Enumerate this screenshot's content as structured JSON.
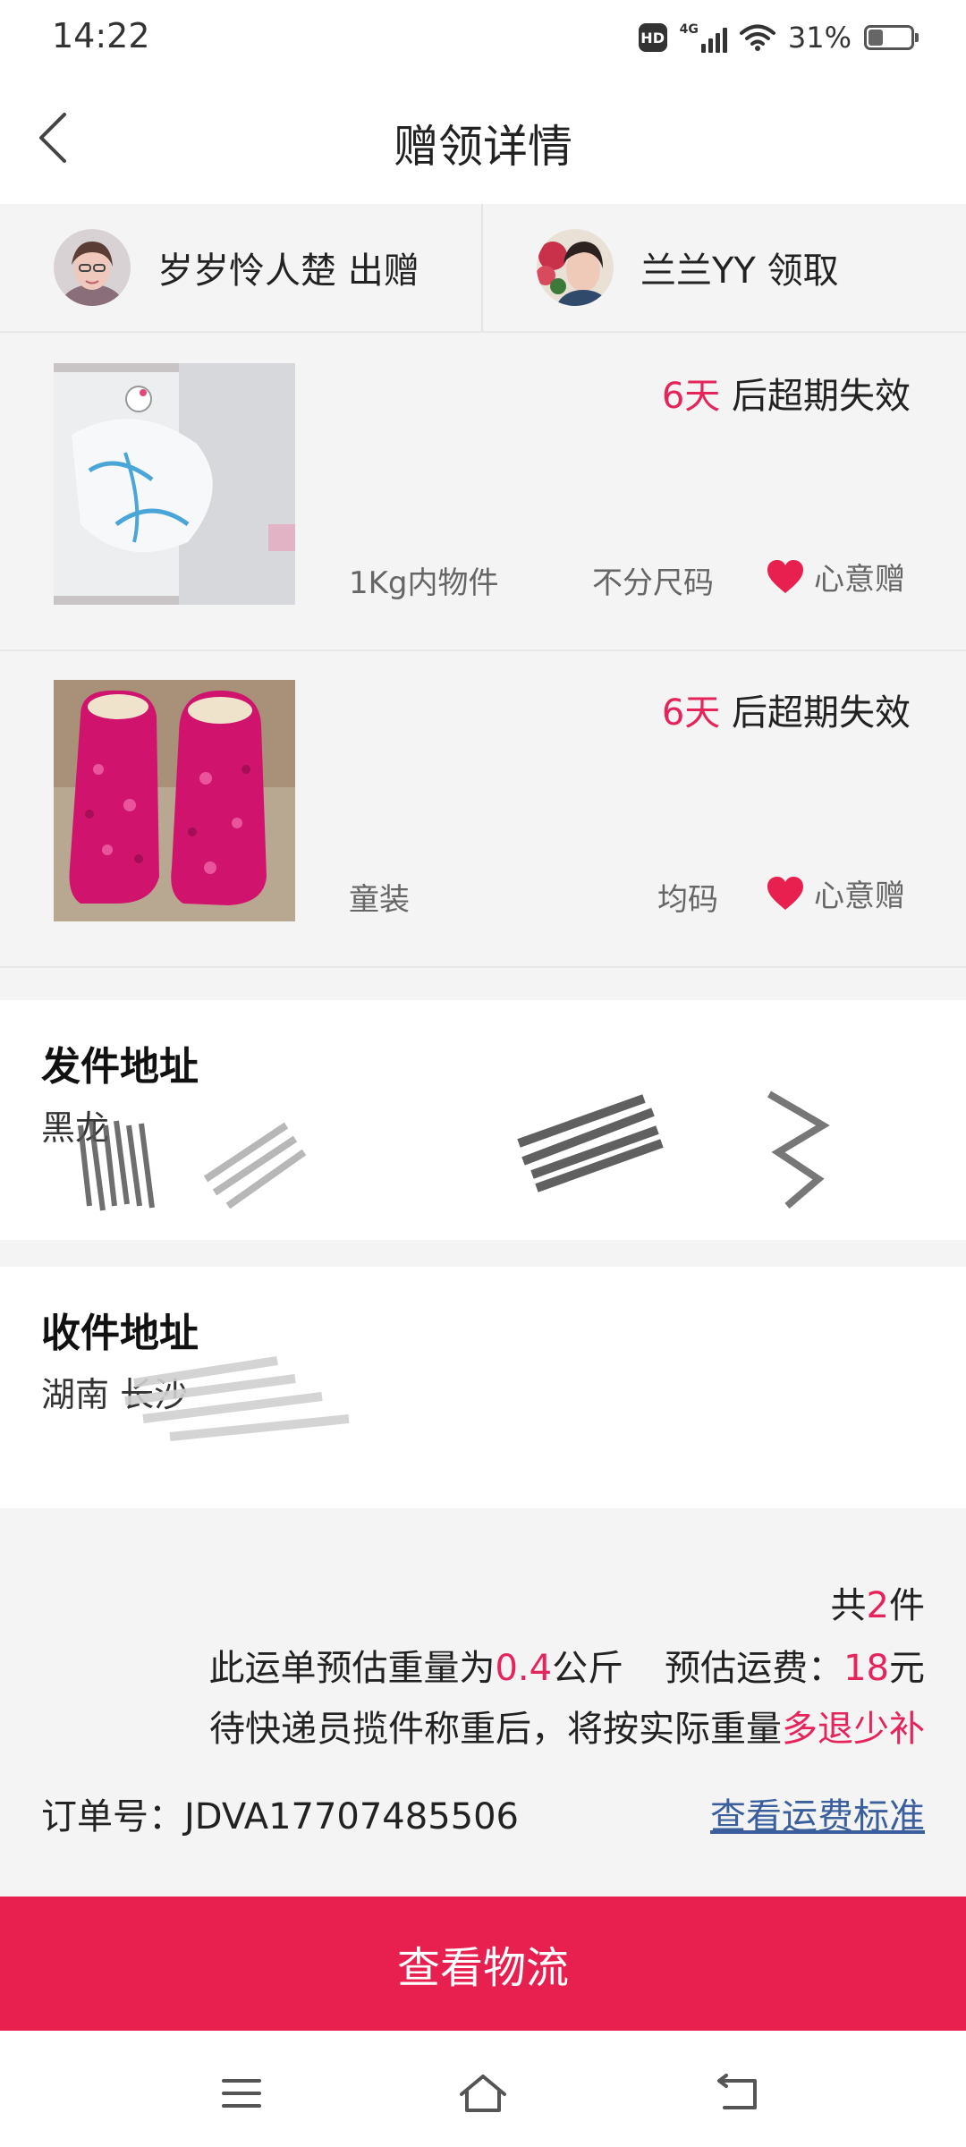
{
  "status_bar": {
    "time": "14:22",
    "hd": "HD",
    "network": "4G",
    "battery_percent": "31%",
    "battery_level": 0.31,
    "icons": [
      "hd-icon",
      "signal-4g-icon",
      "wifi-icon",
      "battery-icon"
    ]
  },
  "header": {
    "title": "赠领详情",
    "back_icon": "chevron-left-icon"
  },
  "users": {
    "giver": {
      "name_label": "岁岁怜人楚 出赠"
    },
    "receiver": {
      "name_label": "兰兰YY 领取"
    }
  },
  "items": [
    {
      "expiry_days": "6天",
      "expiry_suffix": " 后超期失效",
      "category": "1Kg内物件",
      "size": "不分尺码",
      "tag": "心意赠",
      "tag_icon": "heart-icon"
    },
    {
      "expiry_days": "6天",
      "expiry_suffix": " 后超期失效",
      "category": "童装",
      "size": "均码",
      "tag": "心意赠",
      "tag_icon": "heart-icon"
    }
  ],
  "sender_address": {
    "title": "发件地址",
    "text": "黑龙"
  },
  "receiver_address": {
    "title": "收件地址",
    "text": "湖南 长沙"
  },
  "summary": {
    "count_prefix": "共",
    "count": "2",
    "count_suffix": "件",
    "weight_prefix": "此运单预估重量为",
    "weight": "0.4",
    "weight_unit": "公斤",
    "fee_prefix": "预估运费：",
    "fee": "18",
    "fee_unit": "元",
    "note_prefix": "待快递员揽件称重后，将按实际重量",
    "note_highlight": "多退少补",
    "order_label": "订单号：",
    "order_no": "JDVA17707485506",
    "fee_link": "查看运费标准"
  },
  "cta": {
    "label": "查看物流"
  },
  "nav": {
    "icons": [
      "menu-icon",
      "home-icon",
      "back-icon"
    ]
  },
  "colors": {
    "accent": "#e8204f",
    "highlight": "#e5245b",
    "link": "#3a5f9c",
    "background": "#f4f4f4"
  }
}
